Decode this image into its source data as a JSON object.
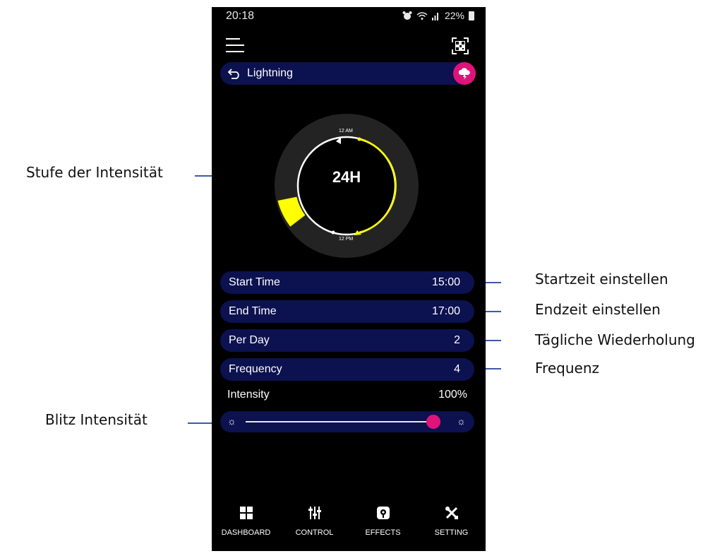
{
  "status": {
    "time": "20:18",
    "battery": "22%",
    "icons": [
      "alarm-icon",
      "wifi-icon",
      "signal-icon",
      "battery-icon"
    ]
  },
  "header": {
    "menu_icon": "menu-icon",
    "qr_icon": "qr-code-icon"
  },
  "title_bar": {
    "label": "Lightning",
    "back_icon": "back-icon",
    "effect_icon": "lightning-cloud-icon"
  },
  "dial": {
    "label": "24H",
    "top_label": "12 AM",
    "bottom_label": "12 PM"
  },
  "rows": [
    {
      "label": "Start Time",
      "value": "15:00"
    },
    {
      "label": "End Time",
      "value": "17:00"
    },
    {
      "label": "Per Day",
      "value": "2"
    },
    {
      "label": "Frequency",
      "value": "4"
    }
  ],
  "intensity": {
    "label": "Intensity",
    "value": "100%",
    "level": 1.0
  },
  "nav": [
    {
      "label": "DASHBOARD",
      "icon": "dashboard-icon"
    },
    {
      "label": "CONTROL",
      "icon": "sliders-icon"
    },
    {
      "label": "EFFECTS",
      "icon": "effects-icon"
    },
    {
      "label": "SETTING",
      "icon": "tools-icon"
    }
  ],
  "annotations": {
    "intensity_level": "Stufe der Intensität",
    "start_time": "Startzeit einstellen",
    "end_time": "Endzeit einstellen",
    "daily_repeat": "Tägliche Wiederholung",
    "frequency": "Frequenz",
    "flash_intensity": "Blitz Intensität"
  },
  "colors": {
    "accent": "#e0137a",
    "pill": "#0c1150",
    "highlight": "#ffff00",
    "dial_ring": "#232323"
  }
}
